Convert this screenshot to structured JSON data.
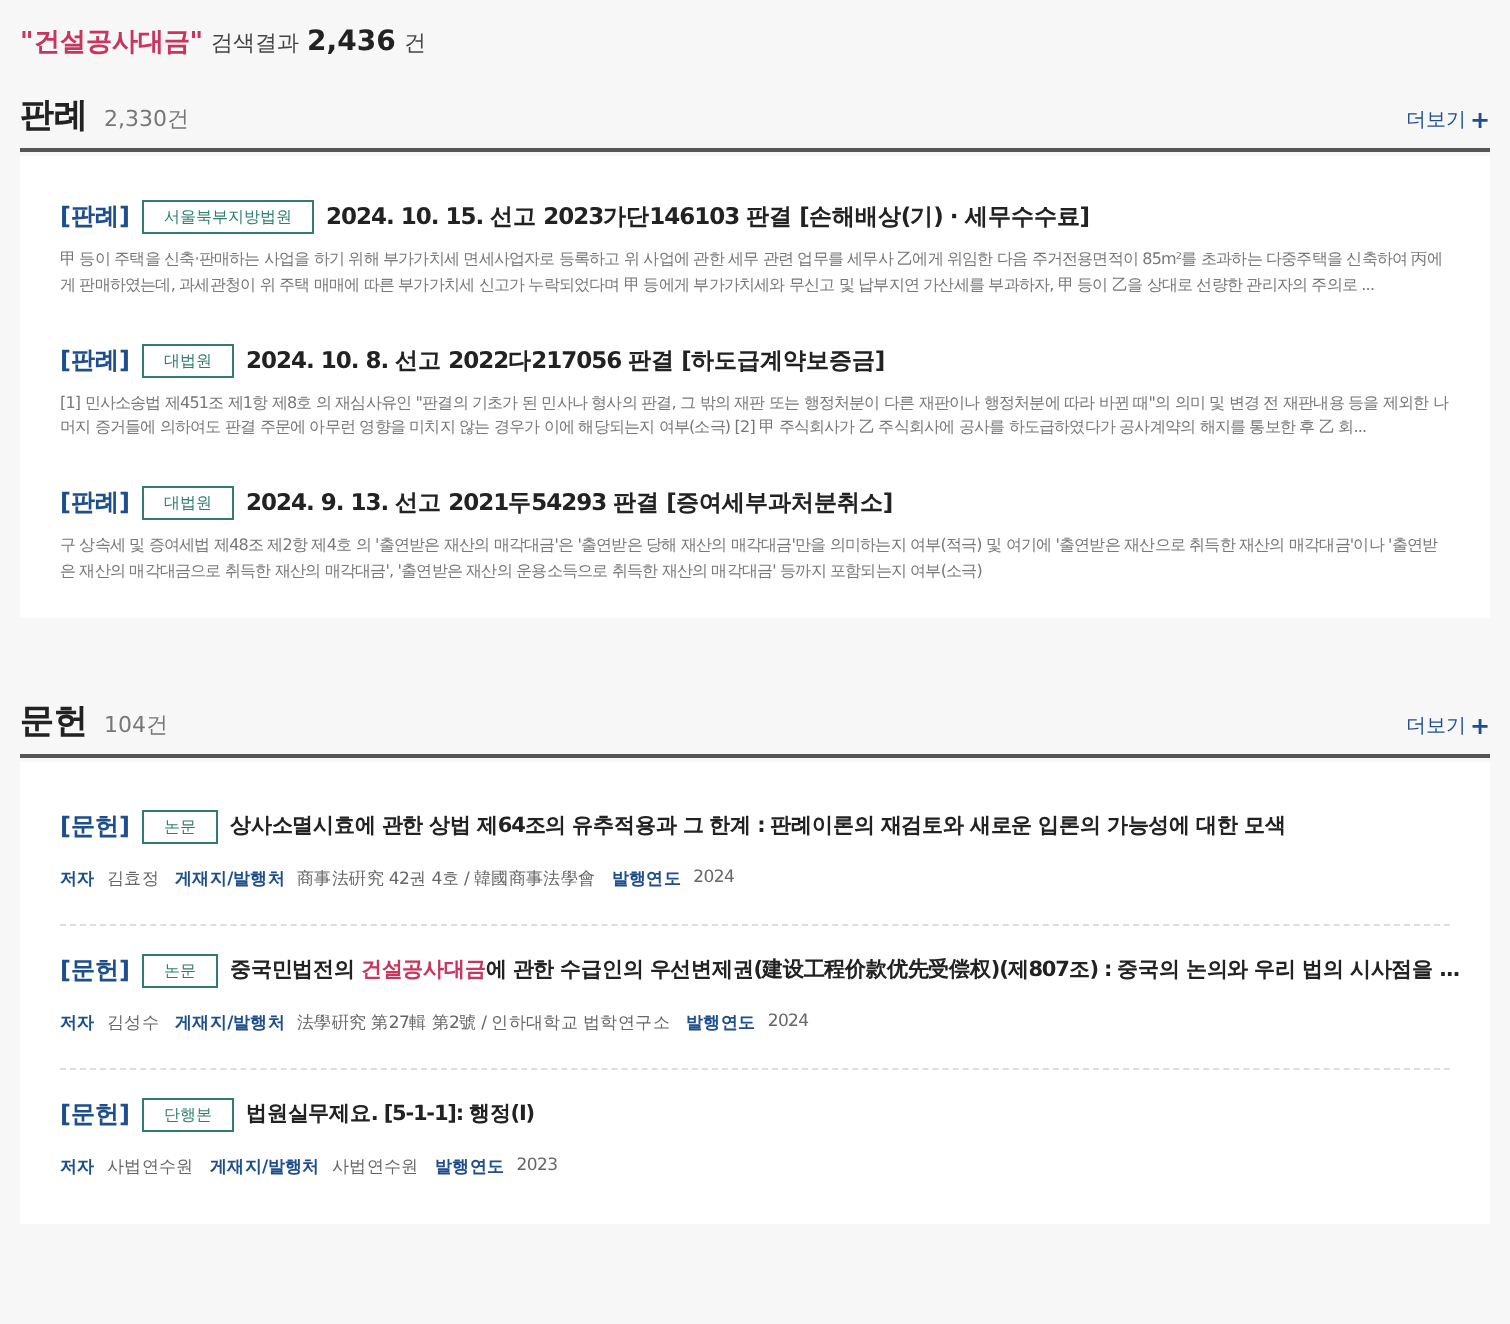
{
  "search_summary": {
    "query": "\"건설공사대금\"",
    "label": "검색결과",
    "count": "2,436",
    "unit": "건"
  },
  "sections": [
    {
      "title": "판례",
      "count": "2,330건",
      "more": "더보기",
      "more_icon": "+",
      "items": [
        {
          "category": "[판례]",
          "tag": "서울북부지방법원",
          "title": [
            {
              "text": "2024. 10. 15. 선고 2023가단146103 판결 [손해배상(기) · 세무수수료]",
              "highlight": false
            }
          ],
          "summary": "甲 등이 주택을 신축·판매하는 사업을 하기 위해 부가가치세 면세사업자로 등록하고 위 사업에 관한 세무 관련 업무를 세무사 乙에게 위임한 다음 주거전용면적이 85m²를 초과하는 다중주택을 신축하여 丙에게 판매하였는데, 과세관청이 위 주택 매매에 따른 부가가치세 신고가 누락되었다며 甲 등에게 부가가치세와 무신고 및 납부지연 가산세를 부과하자, 甲 등이 乙을 상대로 선량한 관리자의 주의로 ..."
        },
        {
          "category": "[판례]",
          "tag": "대법원",
          "title": [
            {
              "text": "2024. 10. 8. 선고 2022다217056 판결 [하도급계약보증금]",
              "highlight": false
            }
          ],
          "summary": "[1] 민사소송법 제451조 제1항 제8호 의 재심사유인 \"판결의 기초가 된 민사나 형사의 판결, 그 밖의 재판 또는 행정처분이 다른 재판이나 행정처분에 따라 바뀐 때\"의 의미 및 변경 전 재판내용 등을 제외한 나머지 증거들에 의하여도 판결 주문에 아무런 영향을 미치지 않는 경우가 이에 해당되는지 여부(소극) [2] 甲 주식회사가 乙 주식회사에 공사를 하도급하였다가 공사계약의 해지를 통보한 후 乙 회..."
        },
        {
          "category": "[판례]",
          "tag": "대법원",
          "title": [
            {
              "text": "2024. 9. 13. 선고 2021두54293 판결 [증여세부과처분취소]",
              "highlight": false
            }
          ],
          "summary": "구 상속세 및 증여세법 제48조 제2항 제4호 의 '출연받은 재산의 매각대금'은 '출연받은 당해 재산의 매각대금'만을 의미하는지 여부(적극) 및 여기에 '출연받은 재산으로 취득한 재산의 매각대금'이나 '출연받은 재산의 매각대금으로 취득한 재산의 매각대금', '출연받은 재산의 운용소득으로 취득한 재산의 매각대금' 등까지 포함되는지 여부(소극)"
        }
      ]
    },
    {
      "title": "문헌",
      "count": "104건",
      "more": "더보기",
      "more_icon": "+",
      "items": [
        {
          "category": "[문헌]",
          "tag": "논문",
          "title": [
            {
              "text": "상사소멸시효에 관한 상법 제64조의 유추적용과 그 한계 : 판례이론의 재검토와 새로운 입론의 가능성에 대한 모색",
              "highlight": false
            }
          ],
          "meta": [
            {
              "label": "저자",
              "value": "김효정"
            },
            {
              "label": "게재지/발행처",
              "value": "商事法硏究 42권 4호 / 韓國商事法學會"
            },
            {
              "label": "발행연도",
              "value": "2024"
            }
          ]
        },
        {
          "category": "[문헌]",
          "tag": "논문",
          "title": [
            {
              "text": "중국민법전의 ",
              "highlight": false
            },
            {
              "text": "건설공사대금",
              "highlight": true
            },
            {
              "text": "에 관한 수급인의 우선변제권(建设工程价款优先受偿权)(제807조) : 중국의 논의와 우리 법의 시사점을 ...",
              "highlight": false
            }
          ],
          "meta": [
            {
              "label": "저자",
              "value": "김성수"
            },
            {
              "label": "게재지/발행처",
              "value": "法學硏究 第27輯 第2號 / 인하대학교 법학연구소"
            },
            {
              "label": "발행연도",
              "value": "2024"
            }
          ]
        },
        {
          "category": "[문헌]",
          "tag": "단행본",
          "title": [
            {
              "text": "법원실무제요. [5-1-1]: 행정(I)",
              "highlight": false
            }
          ],
          "meta": [
            {
              "label": "저자",
              "value": "사법연수원"
            },
            {
              "label": "게재지/발행처",
              "value": "사법연수원"
            },
            {
              "label": "발행연도",
              "value": "2023"
            }
          ]
        }
      ]
    }
  ]
}
